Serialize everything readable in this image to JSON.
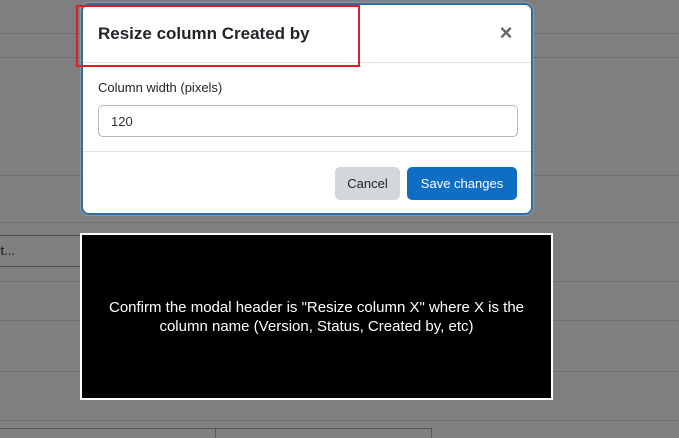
{
  "background": {
    "select_partial_text": "ct..."
  },
  "modal": {
    "title": "Resize column Created by",
    "close_symbol": "×",
    "field_label": "Column width (pixels)",
    "width_value": "120",
    "cancel_label": "Cancel",
    "save_label": "Save changes",
    "border_color": "#2e6da4",
    "save_color": "#0d6ec4"
  },
  "annotation": {
    "highlight_color": "#e01b24",
    "instruction": "Confirm the modal header is \"Resize column X\" where X is the column name (Version, Status, Created by, etc)"
  },
  "icons": {
    "close": "close-icon"
  }
}
